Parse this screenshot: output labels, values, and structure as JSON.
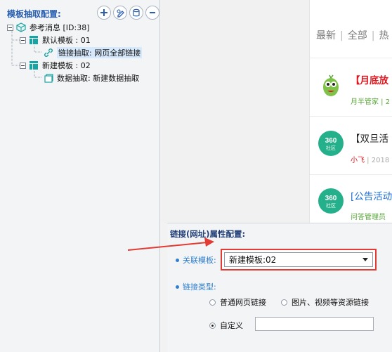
{
  "tree_panel": {
    "title": "模板抽取配置:",
    "toolbar": [
      {
        "name": "add-button",
        "icon": "plus-icon"
      },
      {
        "name": "edit-link-button",
        "icon": "link-edit-icon"
      },
      {
        "name": "add-data-button",
        "icon": "database-add-icon"
      },
      {
        "name": "remove-button",
        "icon": "minus-icon"
      }
    ],
    "nodes": [
      {
        "label": "参考消息 [ID:38]",
        "icon": "cube-icon"
      },
      {
        "label": "默认模板 : 01",
        "icon": "template-icon"
      },
      {
        "label": "链接抽取: 网页全部链接",
        "icon": "link-icon",
        "selected": true
      },
      {
        "label": "新建模板 : 02",
        "icon": "template-icon"
      },
      {
        "label": "数据抽取: 新建数据抽取",
        "icon": "data-extract-icon"
      }
    ]
  },
  "web_preview": {
    "tabs": [
      "最新",
      "全部",
      "热"
    ],
    "items": [
      {
        "title": "【月底放",
        "title_color": "#e0161f",
        "meta": "月半管家 | 2",
        "meta_color": "#5aa53a",
        "avatar": "mascot-avatar",
        "avatar_color": "#7ec24a"
      },
      {
        "title": "【双旦活",
        "title_color": "#222222",
        "meta_author": "小飞",
        "meta_rest": " | 2018",
        "meta_color": "#e0161f",
        "avatar": "360-community-avatar",
        "avatar_text": "360",
        "avatar_sub": "社区",
        "avatar_color": "#24b08a"
      },
      {
        "title": "[公告活动",
        "title_color": "#1f6fd6",
        "meta": "问答管理员",
        "meta_color": "#5aa53a",
        "avatar": "360-community-avatar",
        "avatar_text": "360",
        "avatar_sub": "社区",
        "avatar_color": "#24b08a"
      }
    ]
  },
  "attr_panel": {
    "title": "链接(网址)属性配置:",
    "related_template_label": "关联模板:",
    "related_template_value": "新建模板:02",
    "link_type_label": "链接类型:",
    "link_type_options": [
      {
        "label": "普通网页链接",
        "checked": false
      },
      {
        "label": "图片、视频等资源链接",
        "checked": false
      },
      {
        "label": "自定义",
        "checked": true
      }
    ],
    "custom_value": ""
  },
  "colors": {
    "accent_blue": "#2f7fd0",
    "title_blue": "#2a5fb0",
    "highlight_red": "#e23b33",
    "selected_bg": "#d6e8fb",
    "template_icon": "#1aa3a3"
  }
}
